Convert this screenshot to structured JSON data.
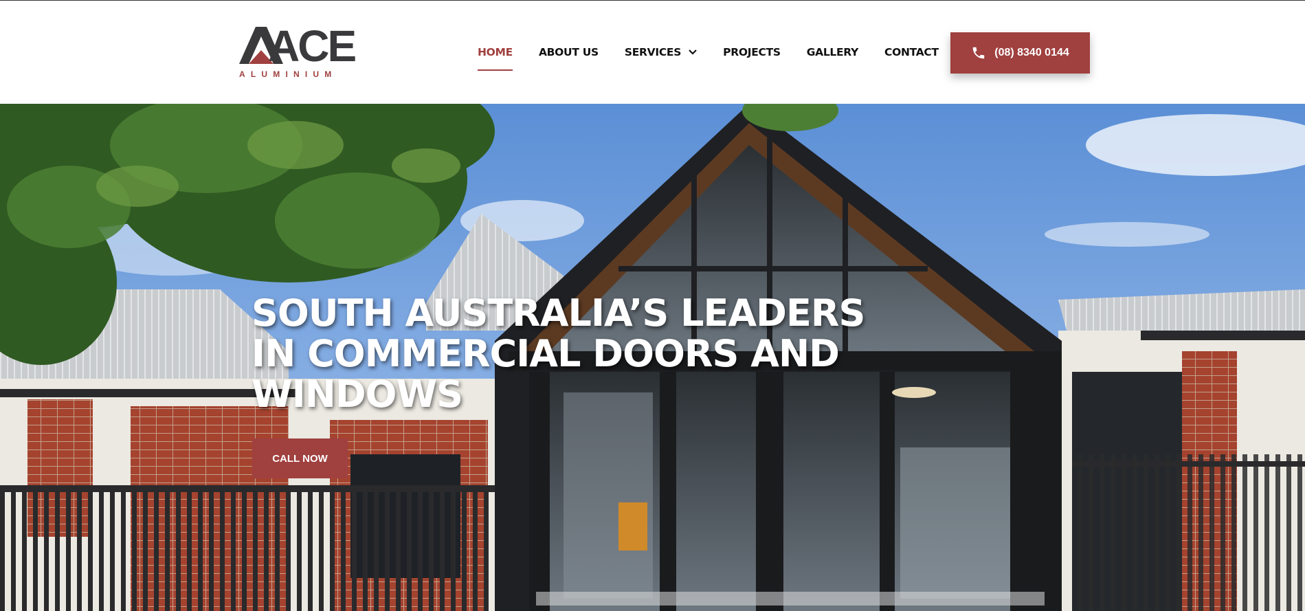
{
  "brand": {
    "logo_word": "ACE",
    "logo_sub": "ALUMINIUM",
    "primary_color": "#a0403f",
    "dark_color": "#3a3a3c"
  },
  "nav": {
    "items": [
      {
        "label": "HOME",
        "active": true
      },
      {
        "label": "ABOUT US",
        "active": false
      },
      {
        "label": "SERVICES",
        "active": false,
        "has_dropdown": true
      },
      {
        "label": "PROJECTS",
        "active": false
      },
      {
        "label": "GALLERY",
        "active": false
      },
      {
        "label": "CONTACT",
        "active": false
      }
    ]
  },
  "header_cta": {
    "icon": "phone-icon",
    "label": "(08) 8340 0144"
  },
  "hero": {
    "title_line1": "SOUTH AUSTRALIA’S LEADERS",
    "title_line2": "IN COMMERCIAL DOORS AND",
    "title_line3": "WINDOWS",
    "cta_label": "CALL NOW"
  }
}
